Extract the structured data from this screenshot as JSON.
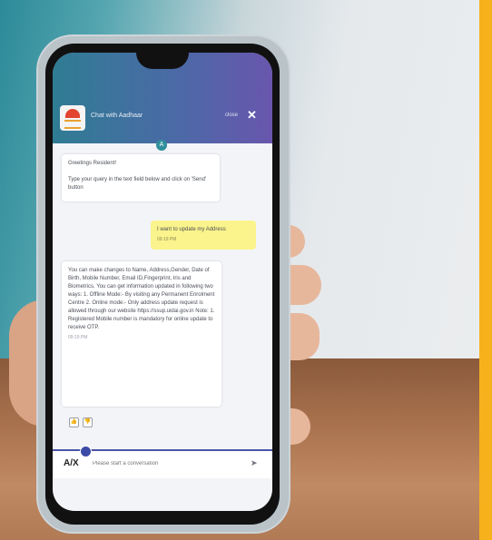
{
  "chat": {
    "title": "Chat with Aadhaar",
    "close_label": "close",
    "close_icon": "✕",
    "avatar_letter": "A",
    "messages": {
      "greeting_line1": "Greetings Resident!",
      "greeting_line2": "Type your query in the text field below and click on 'Send' button",
      "user_msg": "I want to update my Address",
      "user_time": "09:19 PM",
      "bot_reply": "You can make changes to Name, Address,Gender, Date of Birth, Mobile Number, Email ID,Fingerprint, Iris and Biometrics. You can get information updated in following two ways: 1. Offline Mode:- By visiting any Permanent Enrolment Centre 2. Online mode:- Only address update request is allowed through our website https://ssup.uidai.gov.in Note: 1. Registered Mobile number is mandatory for online update to receive OTP.",
      "bot_time": "09:19 PM"
    },
    "feedback": {
      "like": "👍",
      "dislike": "👎"
    },
    "input": {
      "placeholder": "Please start a conversation",
      "translate_label": "A/X",
      "send_icon": "➤"
    }
  },
  "colors": {
    "accent": "#f6b11d",
    "header_start": "#2f7c93",
    "header_end": "#6956ad",
    "user_bubble": "#fbf48c"
  }
}
